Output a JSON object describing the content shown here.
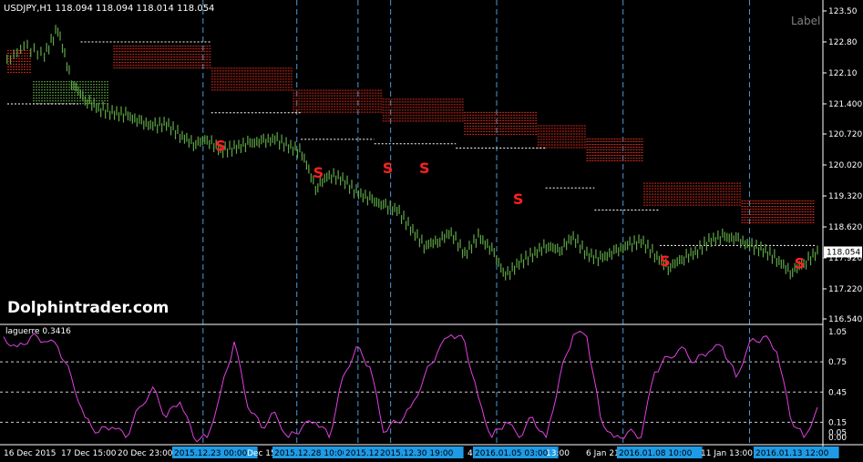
{
  "header": {
    "symbol_info": "USDJPY,H1  118.094 118.094 118.014 118.054"
  },
  "corner_label": "Label",
  "watermark": "Dolphintrader.com",
  "price_axis": {
    "ticks": [
      "123.50",
      "122.80",
      "122.10",
      "121.400",
      "120.720",
      "120.020",
      "119.320",
      "118.620",
      "117.920",
      "117.220",
      "116.540"
    ],
    "current_price": "118.054",
    "range": [
      116.54,
      123.5
    ]
  },
  "indicator": {
    "label": "laguerre 0.3416",
    "ticks": [
      "1.05",
      "0.75",
      "0.45",
      "0.15",
      "0.05",
      "0.00"
    ],
    "levels": [
      0.75,
      0.45,
      0.15
    ]
  },
  "time_axis": {
    "labels": [
      {
        "text": "16 Dec 2015",
        "highlight": false
      },
      {
        "text": "17 Dec 15:00",
        "highlight": false
      },
      {
        "text": "20 Dec 23:00",
        "highlight": false
      },
      {
        "text": "2015.12.23 00:00",
        "highlight": true
      },
      {
        "text": "Dec 15",
        "highlight": false
      },
      {
        "text": "2015.12.28 10:00",
        "highlight": true
      },
      {
        "text": "2015.12.",
        "highlight": true
      },
      {
        "text": "2015.12.30 19:00",
        "highlight": true
      },
      {
        "text": "4",
        "highlight": false
      },
      {
        "text": "2016.01.05 03:00",
        "highlight": true
      },
      {
        "text": "13:00",
        "highlight": false
      },
      {
        "text": "6 Jan 21",
        "highlight": false
      },
      {
        "text": "2016.01.08 10:00",
        "highlight": true
      },
      {
        "text": "11 Jan 13:00",
        "highlight": false
      },
      {
        "text": "2016.01.13 12:00",
        "highlight": true
      }
    ]
  },
  "signals": {
    "label": "S",
    "count": 8
  },
  "colors": {
    "background": "#000000",
    "price_line": "#5fa847",
    "band": "#d42a1a",
    "band_green": "#5fa847",
    "vline": "#4a9ad8",
    "oscillator": "#e040e0",
    "signal": "#ff2020",
    "highlight_bg": "#1e9be6"
  },
  "chart_data": [
    {
      "type": "line",
      "title": "USDJPY,H1",
      "ylim": [
        116.54,
        123.5
      ],
      "series": [
        {
          "name": "USDJPY",
          "x": [
            0,
            6,
            12,
            16,
            20,
            24,
            28,
            32,
            36,
            40,
            44,
            48,
            52,
            56,
            60,
            64,
            68,
            72,
            76,
            80,
            84,
            88,
            92,
            96,
            100,
            104,
            108,
            112,
            116,
            120,
            124,
            128,
            132,
            136,
            140,
            144,
            148,
            152,
            156,
            160,
            164,
            168,
            172,
            176,
            180,
            184,
            188,
            192,
            196,
            200,
            204,
            208,
            212,
            216,
            220,
            224,
            228,
            232,
            236,
            240
          ],
          "y": [
            122.3,
            122.7,
            122.5,
            123.1,
            121.9,
            121.5,
            121.3,
            121.2,
            121.15,
            121.0,
            120.9,
            120.95,
            120.7,
            120.5,
            120.6,
            120.35,
            120.4,
            120.5,
            120.55,
            120.6,
            120.45,
            120.3,
            119.5,
            119.8,
            119.7,
            119.4,
            119.25,
            119.1,
            119.0,
            118.6,
            118.2,
            118.3,
            118.5,
            118.0,
            118.4,
            118.1,
            117.5,
            117.8,
            118.0,
            118.2,
            118.1,
            118.4,
            118.0,
            117.9,
            118.05,
            118.2,
            118.3,
            118.0,
            117.7,
            117.9,
            118.05,
            118.3,
            118.4,
            118.35,
            118.2,
            118.1,
            117.9,
            117.6,
            117.8,
            118.05
          ]
        }
      ]
    },
    {
      "type": "line",
      "title": "laguerre 0.3416",
      "ylim": [
        0,
        1.05
      ],
      "series": [
        {
          "name": "laguerre",
          "x": [
            0,
            4,
            8,
            12,
            16,
            20,
            24,
            28,
            32,
            36,
            40,
            44,
            48,
            52,
            56,
            60,
            64,
            68,
            72,
            76,
            80,
            84,
            88,
            92,
            96,
            100,
            104,
            108,
            112,
            116,
            120,
            124,
            128,
            132,
            136,
            140,
            144,
            148,
            152,
            156,
            160,
            164,
            168,
            172,
            176,
            180,
            184,
            188,
            192,
            196,
            200,
            204,
            208,
            212,
            216,
            220,
            224,
            228,
            232,
            236,
            240
          ],
          "y": [
            1.0,
            0.9,
            1.0,
            0.95,
            0.9,
            0.6,
            0.2,
            0.05,
            0.1,
            0.0,
            0.3,
            0.5,
            0.2,
            0.35,
            0.0,
            0.0,
            0.45,
            0.95,
            0.3,
            0.1,
            0.25,
            0.0,
            0.1,
            0.15,
            0.0,
            0.6,
            0.9,
            0.7,
            0.05,
            0.15,
            0.3,
            0.6,
            0.85,
            1.02,
            0.95,
            0.4,
            0.0,
            0.15,
            0.0,
            0.2,
            0.0,
            0.6,
            1.02,
            1.0,
            0.2,
            0.0,
            0.05,
            0.0,
            0.65,
            0.8,
            0.9,
            0.75,
            0.85,
            0.9,
            0.6,
            0.95,
            1.0,
            0.85,
            0.2,
            0.0,
            0.3
          ]
        }
      ]
    }
  ]
}
